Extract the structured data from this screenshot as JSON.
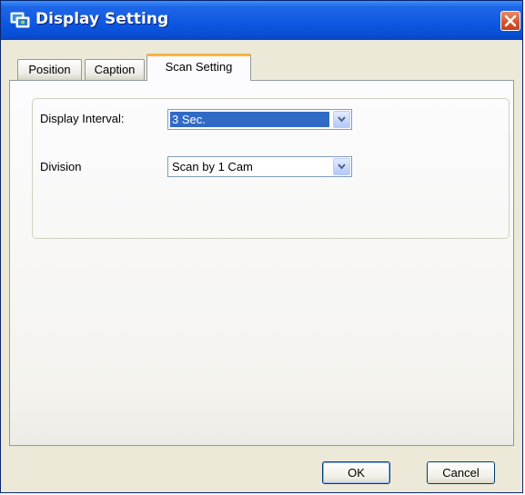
{
  "window": {
    "title": "Display Setting"
  },
  "tabs": [
    {
      "label": "Position",
      "active": false
    },
    {
      "label": "Caption",
      "active": false
    },
    {
      "label": "Scan Setting",
      "active": true
    }
  ],
  "scan_setting": {
    "display_interval": {
      "label": "Display Interval:",
      "value": "3 Sec."
    },
    "division": {
      "label": "Division",
      "value": "Scan by  1 Cam"
    }
  },
  "buttons": {
    "ok": "OK",
    "cancel": "Cancel"
  },
  "colors": {
    "title_bar": "#0a4fd6",
    "active_tab_accent": "#f8b33c",
    "selection": "#316ac5",
    "close_button": "#d5522b"
  }
}
